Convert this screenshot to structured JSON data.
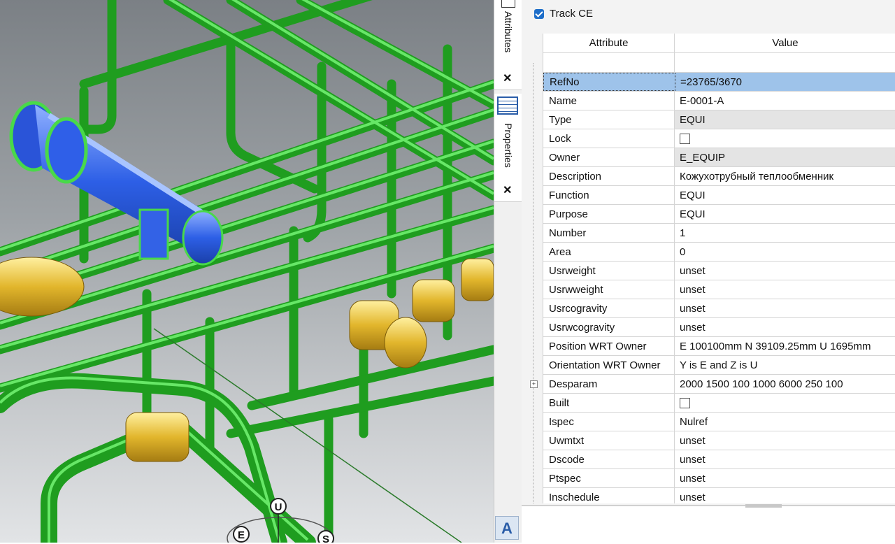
{
  "viewport": {
    "gizmo": {
      "up": "U",
      "east": "E",
      "south": "S"
    }
  },
  "sidetabs": {
    "attributes_label": "Attributes",
    "properties_label": "Properties",
    "close_glyph": "✕"
  },
  "panel": {
    "track_ce_label": "Track CE",
    "track_ce_checked": true,
    "header": {
      "attribute": "Attribute",
      "value": "Value"
    },
    "rows": [
      {
        "attr": "RefNo",
        "value": "=23765/3670"
      },
      {
        "attr": "Name",
        "value": "E-0001-A"
      },
      {
        "attr": "Type",
        "value": "EQUI"
      },
      {
        "attr": "Lock",
        "value": ""
      },
      {
        "attr": "Owner",
        "value": "E_EQUIP"
      },
      {
        "attr": "Description",
        "value": "Кожухотрубный теплообменник"
      },
      {
        "attr": "Function",
        "value": "EQUI"
      },
      {
        "attr": "Purpose",
        "value": "EQUI"
      },
      {
        "attr": "Number",
        "value": "1"
      },
      {
        "attr": "Area",
        "value": "0"
      },
      {
        "attr": "Usrweight",
        "value": "unset"
      },
      {
        "attr": "Usrwweight",
        "value": "unset"
      },
      {
        "attr": "Usrcogravity",
        "value": "unset"
      },
      {
        "attr": "Usrwcogravity",
        "value": "unset"
      },
      {
        "attr": "Position WRT Owner",
        "value": "E 100100mm N 39109.25mm U 1695mm"
      },
      {
        "attr": "Orientation WRT Owner",
        "value": "Y is E and Z is U"
      },
      {
        "attr": "Desparam",
        "value": "2000 1500 100 1000 6000 250 100"
      },
      {
        "attr": "Built",
        "value": ""
      },
      {
        "attr": "Ispec",
        "value": "Nulref"
      },
      {
        "attr": "Uwmtxt",
        "value": "unset"
      },
      {
        "attr": "Dscode",
        "value": "unset"
      },
      {
        "attr": "Ptspec",
        "value": "unset"
      },
      {
        "attr": "Inschedule",
        "value": "unset"
      }
    ]
  },
  "colors": {
    "pipe_green": "#2fcf2f",
    "equipment_blue": "#2f5fe8",
    "pump_yellow": "#e2b62c",
    "selection_blue": "#9ec3ea"
  }
}
